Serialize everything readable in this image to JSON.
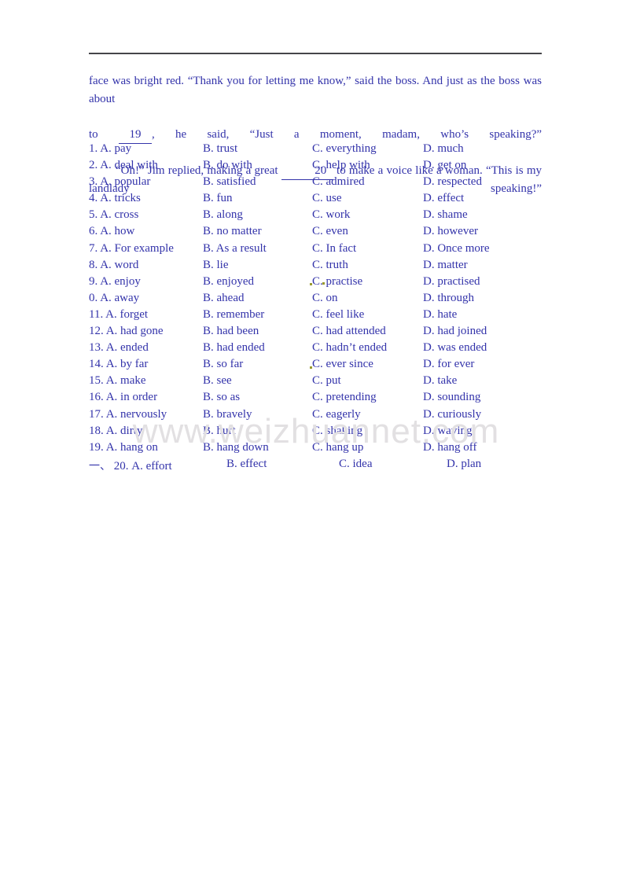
{
  "document": {
    "text_color": "#3333aa",
    "rule_color": "#454549",
    "watermark_color": "#e2e0e2",
    "speck_color": "#9a9a30"
  },
  "watermark": {
    "text": "www.weizhuannet.com"
  },
  "passage": {
    "line1": "face was bright red. “Thank you for letting me know,” said the boss. And just as the boss was about",
    "line2_before": "to",
    "blank_19": "19",
    "line2_after": ", he said, “Just a moment, madam, who’s speaking?”",
    "line3_before": "“Oh!” Jim replied, making a great",
    "blank_20": "20",
    "line3_after": "to make a voice like a woman. “This is my landlady speaking!”"
  },
  "questions": [
    {
      "number": "1.",
      "a": "A. pay",
      "b": "B. trust",
      "c": "C. everything",
      "d": "D. much"
    },
    {
      "number": "2.",
      "a": "A. deal with",
      "b": "B. do with",
      "c": "C. help with",
      "d": "D. get on"
    },
    {
      "number": "3.",
      "a": "A. popular",
      "b": "B. satisfied",
      "c": "C. admired",
      "d": "D. respected"
    },
    {
      "number": "4.",
      "a": "A. tricks",
      "b": "B. fun",
      "c": "C. use",
      "d": "D. effect"
    },
    {
      "number": "5.",
      "a": "A. cross",
      "b": "B. along",
      "c": "C. work",
      "d": "D. shame"
    },
    {
      "number": "6.",
      "a": "A. how",
      "b": "B. no matter",
      "c": "C. even",
      "d": "D. however"
    },
    {
      "number": "7.",
      "a": "A. For example",
      "b": "B. As a result",
      "c": "C. In fact",
      "d": "D. Once more"
    },
    {
      "number": "8.",
      "a": "A. word",
      "b": "B. lie",
      "c": "C. truth",
      "d": "D. matter"
    },
    {
      "number": "9.",
      "a": "A. enjoy",
      "b": "B. enjoyed",
      "c": "C. practise",
      "d": "D. practised"
    },
    {
      "number": "0.",
      "a": "A. away",
      "b": "B. ahead",
      "c": "C. on",
      "d": "D. through"
    },
    {
      "number": "11.",
      "a": "A. forget",
      "b": "B. remember",
      "c": "C. feel like",
      "d": "D. hate"
    },
    {
      "number": "12.",
      "a": "A. had gone",
      "b": "B. had been",
      "c": "C. had attended",
      "d": "D. had joined"
    },
    {
      "number": "13.",
      "a": "A. ended",
      "b": "B. had ended",
      "c": "C. hadn’t ended",
      "d": "D. was ended"
    },
    {
      "number": "14.",
      "a": "A. by far",
      "b": "B. so far",
      "c": "C. ever since",
      "d": "D. for ever"
    },
    {
      "number": "15.",
      "a": "A. make",
      "b": "B. see",
      "c": "C. put",
      "d": "D. take"
    },
    {
      "number": "16.",
      "a": "A. in order",
      "b": "B. so as",
      "c": "C. pretending",
      "d": "D. sounding"
    },
    {
      "number": "17.",
      "a": "A. nervously",
      "b": "B. bravely",
      "c": "C. eagerly",
      "d": "D. curiously"
    },
    {
      "number": "18.",
      "a": "A. dirty",
      "b": "B. hurt",
      "c": "C. shaking",
      "d": "D. waving"
    },
    {
      "number": "19.",
      "a": "A. hang on",
      "b": "B. hang down",
      "c": "C. hang up",
      "d": "D. hang off"
    },
    {
      "number": "20.",
      "marker": "一、",
      "a": "A. effort",
      "b": "B. effect",
      "c": "C. idea",
      "d": "D. plan"
    }
  ]
}
